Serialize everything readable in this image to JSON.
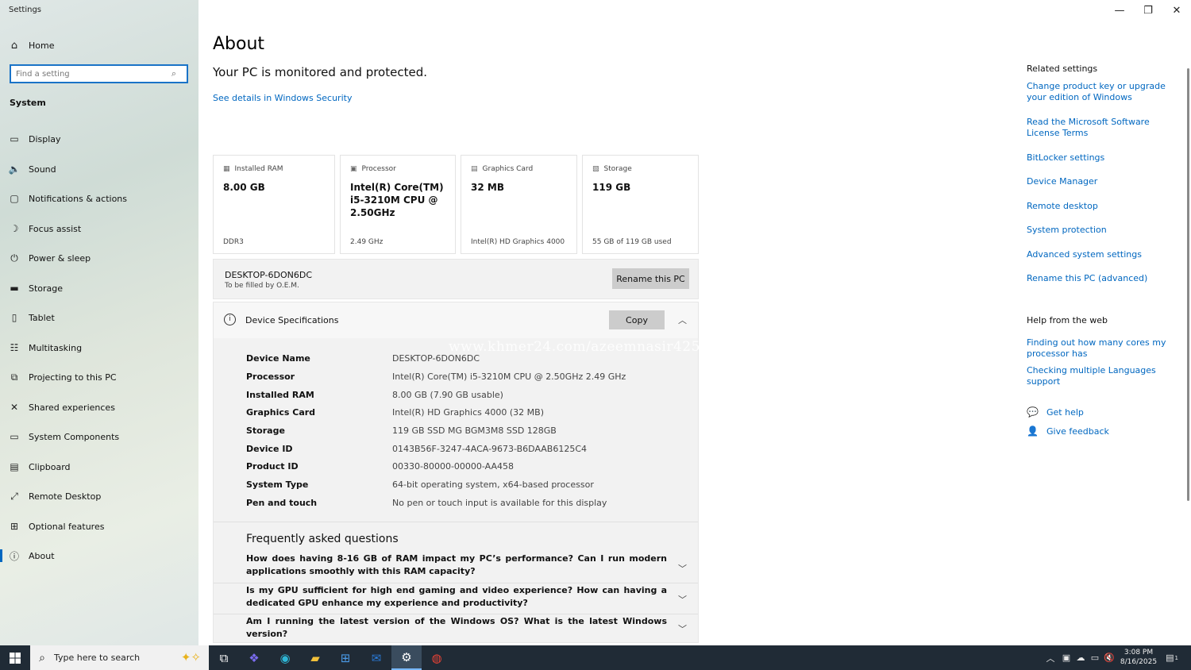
{
  "window": {
    "title": "Settings",
    "minimize": "—",
    "maximize": "❐",
    "close": "✕"
  },
  "sidebar": {
    "home": {
      "icon": "home-icon",
      "label": "Home"
    },
    "search_placeholder": "Find a setting",
    "section": "System",
    "items": [
      {
        "icon": "display-icon",
        "label": "Display"
      },
      {
        "icon": "sound-icon",
        "label": "Sound"
      },
      {
        "icon": "notifications-icon",
        "label": "Notifications & actions"
      },
      {
        "icon": "focus-assist-icon",
        "label": "Focus assist"
      },
      {
        "icon": "power-icon",
        "label": "Power & sleep"
      },
      {
        "icon": "storage-icon",
        "label": "Storage"
      },
      {
        "icon": "tablet-icon",
        "label": "Tablet"
      },
      {
        "icon": "multitasking-icon",
        "label": "Multitasking"
      },
      {
        "icon": "projecting-icon",
        "label": "Projecting to this PC"
      },
      {
        "icon": "shared-experiences-icon",
        "label": "Shared experiences"
      },
      {
        "icon": "system-components-icon",
        "label": "System Components"
      },
      {
        "icon": "clipboard-icon",
        "label": "Clipboard"
      },
      {
        "icon": "remote-desktop-icon",
        "label": "Remote Desktop"
      },
      {
        "icon": "optional-features-icon",
        "label": "Optional features"
      },
      {
        "icon": "about-icon",
        "label": "About"
      }
    ],
    "active_item": "About"
  },
  "main": {
    "title": "About",
    "protected": "Your PC is monitored and protected.",
    "security_link": "See details in Windows Security",
    "cards": [
      {
        "icon": "ram-icon",
        "caption": "Installed RAM",
        "value": "8.00 GB",
        "sub": "DDR3"
      },
      {
        "icon": "processor-icon",
        "caption": "Processor",
        "value": "Intel(R) Core(TM) i5-3210M CPU @ 2.50GHz",
        "sub": "2.49 GHz"
      },
      {
        "icon": "graphics-card-icon",
        "caption": "Graphics Card",
        "value": "32 MB",
        "sub": "Intel(R) HD Graphics 4000"
      },
      {
        "icon": "storage-icon",
        "caption": "Storage",
        "value": "119 GB",
        "sub": "55 GB of 119 GB used"
      }
    ],
    "pc": {
      "name": "DESKTOP-6DON6DC",
      "oem": "To be filled by O.E.M.",
      "rename_button": "Rename this PC"
    },
    "specs": {
      "title": "Device Specifications",
      "copy_button": "Copy",
      "rows": [
        {
          "key": "Device Name",
          "value": "DESKTOP-6DON6DC"
        },
        {
          "key": "Processor",
          "value": "Intel(R) Core(TM) i5-3210M CPU @ 2.50GHz   2.49 GHz"
        },
        {
          "key": "Installed RAM",
          "value": "8.00 GB (7.90 GB usable)"
        },
        {
          "key": "Graphics Card",
          "value": "Intel(R) HD Graphics 4000 (32 MB)"
        },
        {
          "key": "Storage",
          "value": "119 GB SSD MG  BGM3M8  SSD  128GB"
        },
        {
          "key": "Device ID",
          "value": "0143B56F-3247-4ACA-9673-B6DAAB6125C4"
        },
        {
          "key": "Product ID",
          "value": "00330-80000-00000-AA458"
        },
        {
          "key": "System Type",
          "value": "64-bit operating system, x64-based processor"
        },
        {
          "key": "Pen and touch",
          "value": "No pen or touch input is available for this display"
        }
      ]
    },
    "faq": {
      "title": "Frequently asked questions",
      "questions": [
        "How does having 8-16 GB of RAM impact my PC’s performance? Can I run modern applications smoothly with this RAM capacity?",
        "Is my GPU sufficient for high end gaming and video experience? How can having a dedicated GPU enhance my experience and productivity?",
        "Am I running the latest version of the Windows OS? What is the latest Windows version?"
      ]
    },
    "watermark": "www.khmer24.com/azeemnasir425"
  },
  "related": {
    "title": "Related settings",
    "links": [
      "Change product key or upgrade your edition of Windows",
      "Read the Microsoft Software License Terms",
      "BitLocker settings",
      "Device Manager",
      "Remote desktop",
      "System protection",
      "Advanced system settings",
      "Rename this PC (advanced)"
    ]
  },
  "help_web": {
    "title": "Help from the web",
    "links": [
      "Finding out how many cores my processor has",
      "Checking multiple Languages support"
    ]
  },
  "support": {
    "get_help": "Get help",
    "give_feedback": "Give feedback"
  },
  "taskbar": {
    "search_text": "Type here to search",
    "apps": [
      "task-view-icon",
      "copilot-icon",
      "edge-icon",
      "file-explorer-icon",
      "store-icon",
      "outlook-icon",
      "settings-icon",
      "chrome-icon"
    ],
    "time": "3:08 PM",
    "date": "8/16/2025",
    "notification_count": "1"
  },
  "colors": {
    "accent": "#0067c0",
    "taskbar": "#202b36"
  }
}
